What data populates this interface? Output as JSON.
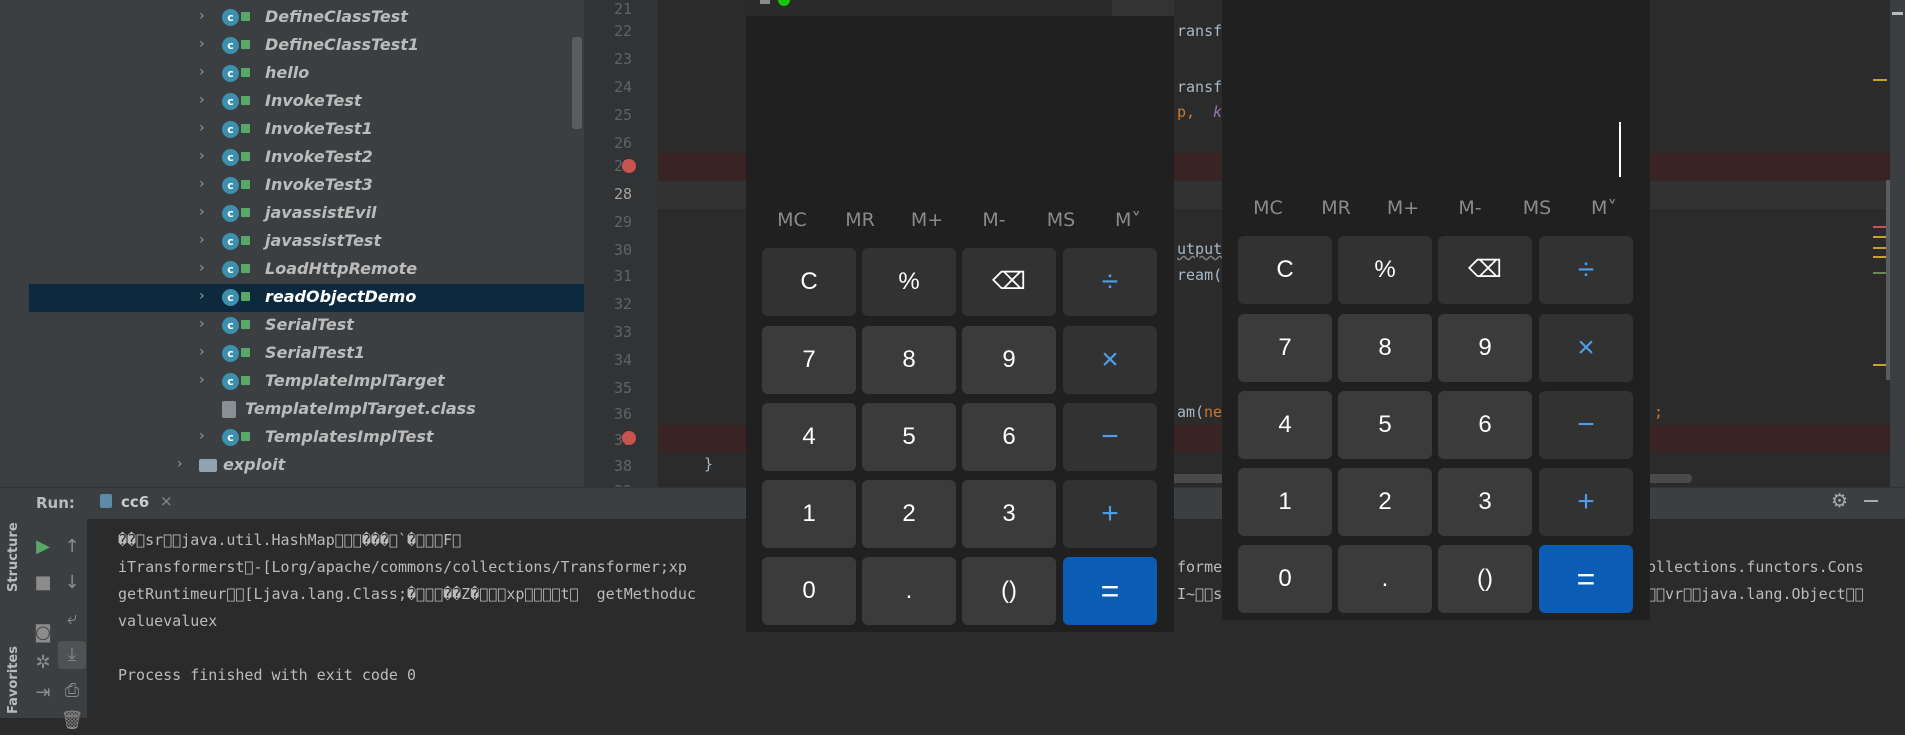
{
  "tree": {
    "items": [
      {
        "label": "DefineClassTest"
      },
      {
        "label": "DefineClassTest1"
      },
      {
        "label": "hello"
      },
      {
        "label": "InvokeTest"
      },
      {
        "label": "InvokeTest1"
      },
      {
        "label": "InvokeTest2"
      },
      {
        "label": "InvokeTest3"
      },
      {
        "label": "javassistEvil"
      },
      {
        "label": "javassistTest"
      },
      {
        "label": "LoadHttpRemote"
      },
      {
        "label": "readObjectDemo"
      },
      {
        "label": "SerialTest"
      },
      {
        "label": "SerialTest1"
      },
      {
        "label": "TemplateImplTarget"
      },
      {
        "label": "TemplateImplTarget.class"
      },
      {
        "label": "TemplatesImplTest"
      },
      {
        "label": "exploit"
      }
    ],
    "selected": "readObjectDemo"
  },
  "editor": {
    "line_numbers": [
      "21",
      "22",
      "23",
      "24",
      "25",
      "26",
      "27",
      "28",
      "29",
      "30",
      "31",
      "32",
      "33",
      "34",
      "35",
      "36",
      "37",
      "38",
      "39"
    ],
    "visible_code": {
      "l22": "ransf",
      "l24": "ransf",
      "l25_a": "p,",
      "l25_b": "k",
      "l30": "utput",
      "l31": "ream(",
      "l36_a": "am(",
      "l36_b": "ne",
      "l36_c": ";",
      "l38": "}"
    }
  },
  "run": {
    "label": "Run:",
    "tab": "cc6",
    "output": [
      "��\u0000sr\u0000\u0000java.util.HashMap\u0000\u0000\u0000���\u0000`�\u0000\u0000\u0000F\u0000",
      "iTransformerst\u0000-[Lorg/apache/commons/collections/Transformer;xp",
      "getRuntimeur\u0000\u0000[Ljava.lang.Class;�\u0000\u0000\u0000��Z�\u0000\u0000\u0000xp\u0000\u0000\u0000\u0000t\u0000  getMethoduc",
      "valuevaluex",
      "",
      "Process finished with exit code 0"
    ],
    "output_right": [
      "former",
      "ollections.functors.Cons",
      "I~\u0000\u0000s",
      "\u0000\u0000vr\u0000\u0000java.lang.Object\u0000\u0000"
    ]
  },
  "side_labels": {
    "structure": "Structure",
    "favorites": "Favorites"
  },
  "calculator_keys": {
    "memory": [
      "MC",
      "MR",
      "M+",
      "M-",
      "MS",
      "M˅"
    ],
    "rows": [
      [
        "C",
        "%",
        "⌫",
        "÷"
      ],
      [
        "7",
        "8",
        "9",
        "×"
      ],
      [
        "4",
        "5",
        "6",
        "−"
      ],
      [
        "1",
        "2",
        "3",
        "+"
      ],
      [
        "0",
        ".",
        "()",
        "="
      ]
    ]
  },
  "colors": {
    "accent": "#0a5cb5",
    "operator": "#4f9de8",
    "breakpoint": "#c75450",
    "selection": "#0d293e"
  }
}
